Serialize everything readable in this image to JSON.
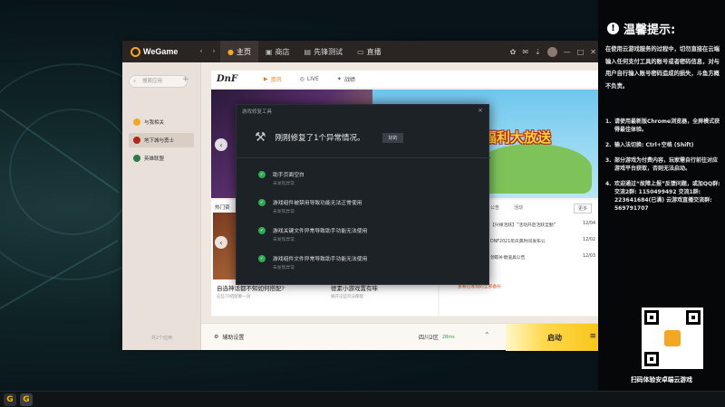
{
  "wegame": {
    "brand": "WeGame",
    "nav_back": "‹",
    "nav_forward": "›",
    "tabs": [
      {
        "label": "主页",
        "icon": "home"
      },
      {
        "label": "商店",
        "icon": "store"
      },
      {
        "label": "先锋测试",
        "icon": "test"
      },
      {
        "label": "直播",
        "icon": "live"
      }
    ],
    "window_controls": [
      "—",
      "□",
      "✕"
    ]
  },
  "sidebar": {
    "search_placeholder": "搜索应用",
    "add": "+",
    "items": [
      {
        "label": "与我相关",
        "color": "#f5a623"
      },
      {
        "label": "地下城与勇士",
        "color": "#b0261a"
      },
      {
        "label": "英雄联盟",
        "color": "#2a7a4a"
      }
    ],
    "footer": "共2个应用"
  },
  "game": {
    "logo": "DnF",
    "tabs": [
      {
        "label": "资讯",
        "icon": "▶"
      },
      {
        "label": "LIVE",
        "icon": "◎"
      },
      {
        "label": "战绩",
        "icon": "✦"
      }
    ],
    "banner_text": "福利大放送",
    "hot_title": "热门资",
    "hot_cards": [
      {
        "title": "自选神话都不知如何搭配?",
        "sub": "这些70搭配看一试"
      },
      {
        "title": "德素小游戏置有味",
        "sub": "展开这些玩法都能"
      }
    ],
    "news_tabs": [
      "公告",
      "活动"
    ],
    "news_more": "更多",
    "news_rows": [
      {
        "text": "【兴缘活跃】“活动开启活跃全勤”",
        "date": "12/04"
      },
      {
        "text": "DNF2021年庆典时间发布公",
        "date": "12/02"
      },
      {
        "text": "领取补偿道具公告",
        "date": "12/03"
      }
    ],
    "news_link": "查看已发现的全部备份"
  },
  "launch_bar": {
    "aux_settings": "辅助设置",
    "server": "四川2区",
    "latency": "28ms",
    "launch_label": "启动"
  },
  "repair_dialog": {
    "title": "游戏修复工具",
    "message": "刚刚修复了1个异常情况。",
    "ok": "好的",
    "items": [
      {
        "title": "助手页面空白",
        "status": "未发现异常"
      },
      {
        "title": "游戏组件被禁用导致功能无法正常使用",
        "status": "未发现异常"
      },
      {
        "title": "游戏关键文件异常导致助手功能无法使用",
        "status": "未发现异常"
      },
      {
        "title": "游戏组件文件异常导致助手功能无法使用",
        "status": "未发现异常"
      }
    ]
  },
  "notice": {
    "title": "温馨提示:",
    "body": "在使用云游戏服务的过程中，切勿直接在云端输入任何支付工具的账号或者密码信息，对与用户自行输入账号密码造成的损失，斗鱼方概不负责。",
    "list": [
      "请使用最新版Chrome浏览器，全屏模式获得最佳体验。",
      "输入法切换: Ctrl+空格 (Shift)",
      "部分游戏为付费内容，玩家需自行前往对应游戏平台获取，否则无法启动。",
      "欢迎通过“故障上报”反馈问题，或加QQ群: 交流2群: 1150499492 交流1群: 223641684(已满) 云游戏直播交流群: 569791707"
    ],
    "qr_caption": "扫码体验安卓端云游戏"
  },
  "taskbar": {
    "items": [
      "G",
      "G"
    ]
  }
}
